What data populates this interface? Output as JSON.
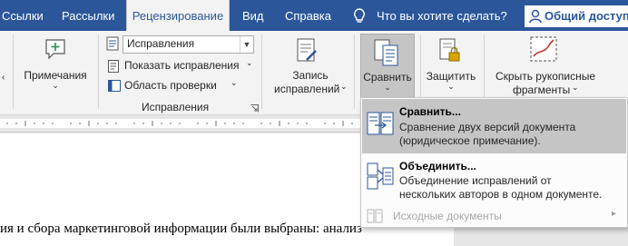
{
  "tabs": [
    {
      "label": "Ссылки",
      "active": false
    },
    {
      "label": "Рассылки",
      "active": false
    },
    {
      "label": "Рецензирование",
      "active": true
    },
    {
      "label": "Вид",
      "active": false
    },
    {
      "label": "Справка",
      "active": false
    }
  ],
  "tell_me": "Что вы хотите сделать?",
  "share_label": "Общий доступ",
  "ribbon": {
    "comments_label": "Примечания",
    "tracking": {
      "display_mode": "Исправления",
      "show_markup": "Показать исправления",
      "review_pane": "Область проверки",
      "group_label": "Исправления"
    },
    "record_changes": {
      "line1": "Запись",
      "line2": "исправлений"
    },
    "compare_label": "Сравнить",
    "protect_label": "Защитить",
    "hide_ink": {
      "line1": "Скрыть рукописные",
      "line2": "фрагменты"
    }
  },
  "document": {
    "line1": "ия и сбора маркетинговой информации были выбраны: анализ"
  },
  "compare_menu": {
    "items": [
      {
        "title": "Сравнить...",
        "description_line1": "Сравнение двух версий документа",
        "description_line2": "(юридическое примечание).",
        "highlighted": true
      },
      {
        "title": "Объединить...",
        "description_line1": "Объединение исправлений от",
        "description_line2": "нескольких авторов в одном документе.",
        "highlighted": false
      }
    ],
    "source_documents": "Исходные документы"
  },
  "colors": {
    "accent": "#2b579a",
    "ribbon_bg": "#f3f3f3",
    "hover": "#c5c5c5"
  }
}
